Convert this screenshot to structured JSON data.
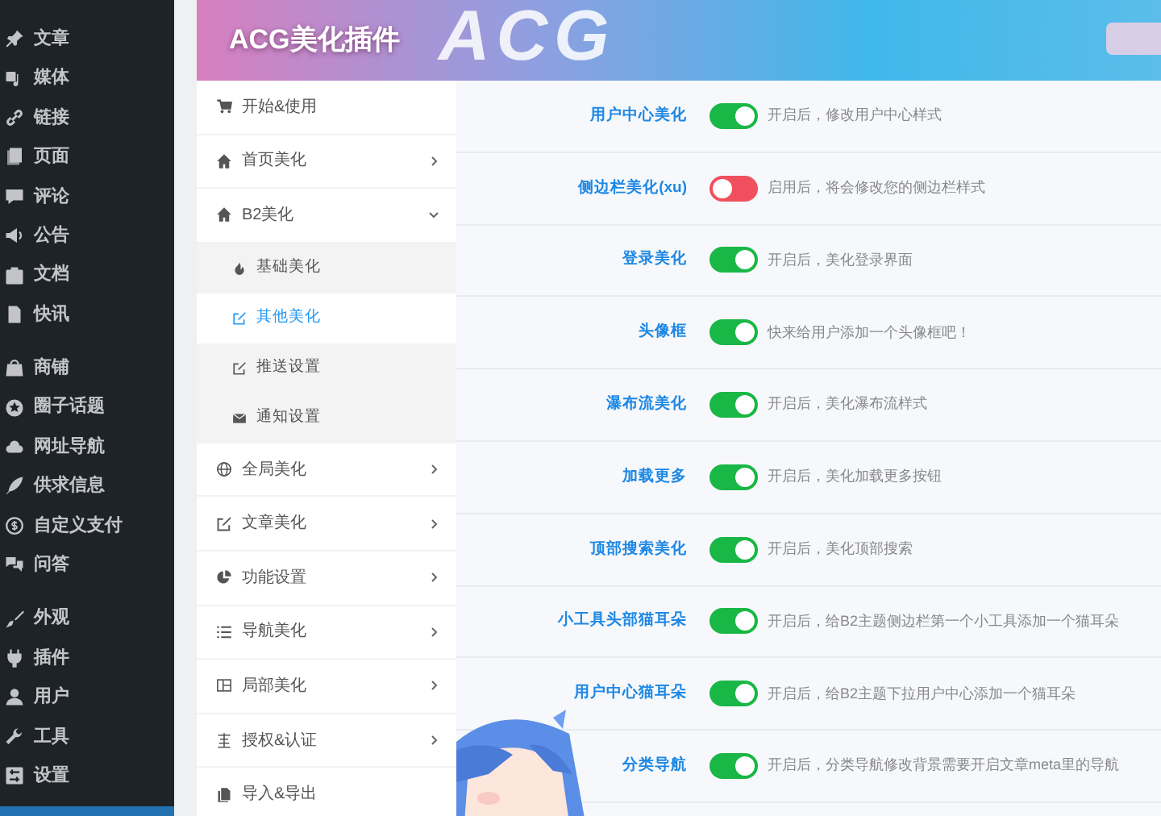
{
  "wp_menu": [
    [
      {
        "label": "文章"
      },
      {
        "label": "媒体"
      },
      {
        "label": "链接"
      },
      {
        "label": "页面"
      },
      {
        "label": "评论"
      },
      {
        "label": "公告"
      },
      {
        "label": "文档"
      },
      {
        "label": "快讯"
      }
    ],
    [
      {
        "label": "商铺"
      },
      {
        "label": "圈子话题"
      },
      {
        "label": "网址导航"
      },
      {
        "label": "供求信息"
      },
      {
        "label": "自定义支付"
      },
      {
        "label": "问答"
      }
    ],
    [
      {
        "label": "外观"
      },
      {
        "label": "插件"
      },
      {
        "label": "用户"
      },
      {
        "label": "工具"
      },
      {
        "label": "设置"
      }
    ]
  ],
  "plugin": {
    "title": "ACG美化插件",
    "header_mark": "ACG"
  },
  "nav": [
    {
      "label": "开始&使用",
      "selected": false
    },
    {
      "label": "首页美化",
      "selected": false,
      "expanded": false
    },
    {
      "label": "B2美化",
      "selected": false,
      "expanded": true,
      "children": [
        {
          "label": "基础美化",
          "selected": false
        },
        {
          "label": "其他美化",
          "selected": true
        },
        {
          "label": "推送设置",
          "selected": false
        },
        {
          "label": "通知设置",
          "selected": false
        }
      ]
    },
    {
      "label": "全局美化",
      "selected": false,
      "expanded": false
    },
    {
      "label": "文章美化",
      "selected": false,
      "expanded": false
    },
    {
      "label": "功能设置",
      "selected": false,
      "expanded": false
    },
    {
      "label": "导航美化",
      "selected": false,
      "expanded": false
    },
    {
      "label": "局部美化",
      "selected": false,
      "expanded": false
    },
    {
      "label": "授权&认证",
      "selected": false,
      "expanded": false
    },
    {
      "label": "导入&导出",
      "selected": false
    }
  ],
  "settings": [
    {
      "label": "用户中心美化",
      "on": true,
      "description": "开启后，修改用户中心样式"
    },
    {
      "label": "侧边栏美化(xu)",
      "on": false,
      "description": "启用后，将会修改您的侧边栏样式"
    },
    {
      "label": "登录美化",
      "on": true,
      "description": "开启后，美化登录界面"
    },
    {
      "label": "头像框",
      "on": true,
      "description": "快来给用户添加一个头像框吧！"
    },
    {
      "label": "瀑布流美化",
      "on": true,
      "description": "开启后，美化瀑布流样式"
    },
    {
      "label": "加载更多",
      "on": true,
      "description": "开启后，美化加载更多按钮"
    },
    {
      "label": "顶部搜索美化",
      "on": true,
      "description": "开启后，美化顶部搜索"
    },
    {
      "label": "小工具头部猫耳朵",
      "on": true,
      "description": "开启后，给B2主题侧边栏第一个小工具添加一个猫耳朵"
    },
    {
      "label": "用户中心猫耳朵",
      "on": true,
      "description": "开启后，给B2主题下拉用户中心添加一个猫耳朵"
    },
    {
      "label": "分类导航",
      "on": true,
      "description": "开启后，分类导航修改背景需要开启文章meta里的导航"
    }
  ]
}
